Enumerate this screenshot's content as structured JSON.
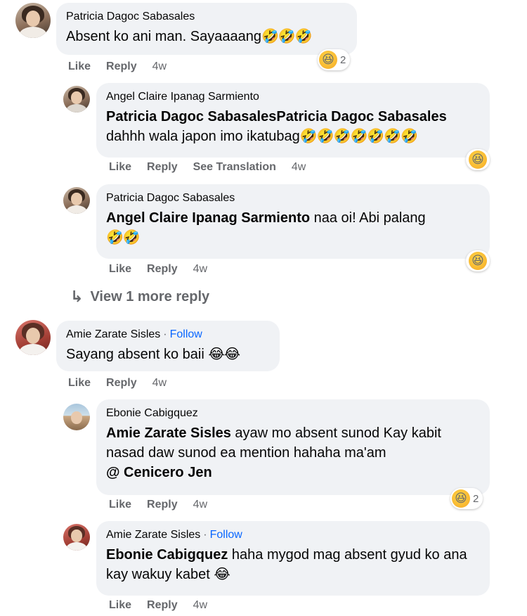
{
  "comments": [
    {
      "author": "Patricia Dagoc Sabasales",
      "text": "Absent ko ani man. Sayaaaang",
      "emoji": "🤣🤣🤣",
      "reaction_emoji": "😆",
      "reaction_count": "2",
      "actions": {
        "like": "Like",
        "reply": "Reply",
        "time": "4w"
      },
      "replies": [
        {
          "author": "Angel Claire Ipanag Sarmiento",
          "mention": "Patricia Dagoc SabasalesPatricia Dagoc Sabasales",
          "text": "dahhh wala japon imo ikatubag",
          "emoji": "🤣🤣🤣🤣🤣🤣🤣",
          "reaction_emoji": "😆",
          "actions": {
            "like": "Like",
            "reply": "Reply",
            "translate": "See Translation",
            "time": "4w"
          }
        },
        {
          "author": "Patricia Dagoc Sabasales",
          "mention": "Angel Claire Ipanag Sarmiento",
          "text": " naa oi! Abi palang",
          "emoji": "🤣🤣",
          "reaction_emoji": "😆",
          "actions": {
            "like": "Like",
            "reply": "Reply",
            "time": "4w"
          }
        }
      ],
      "more_replies": "View 1 more reply"
    },
    {
      "author": "Amie Zarate Sisles",
      "follow": "Follow",
      "text": "Sayang absent ko baii ",
      "emoji": "😂😂",
      "actions": {
        "like": "Like",
        "reply": "Reply",
        "time": "4w"
      },
      "replies": [
        {
          "author": "Ebonie Cabigquez",
          "mention": "Amie Zarate Sisles",
          "text": " ayaw mo absent sunod Kay kabit nasad daw sunod ea mention hahaha ma'am",
          "mention2": "@ Cenicero Jen",
          "reaction_emoji": "😆",
          "reaction_count": "2",
          "actions": {
            "like": "Like",
            "reply": "Reply",
            "time": "4w"
          }
        },
        {
          "author": "Amie Zarate Sisles",
          "follow": "Follow",
          "mention": "Ebonie Cabigquez",
          "text": " haha mygod mag absent gyud ko ana kay wakuy kabet ",
          "emoji": "😂",
          "actions": {
            "like": "Like",
            "reply": "Reply",
            "time": "4w"
          }
        }
      ]
    }
  ],
  "icons": {
    "reply_arrow": "reply-arrow-icon",
    "reaction": "laughing-reaction-icon"
  }
}
